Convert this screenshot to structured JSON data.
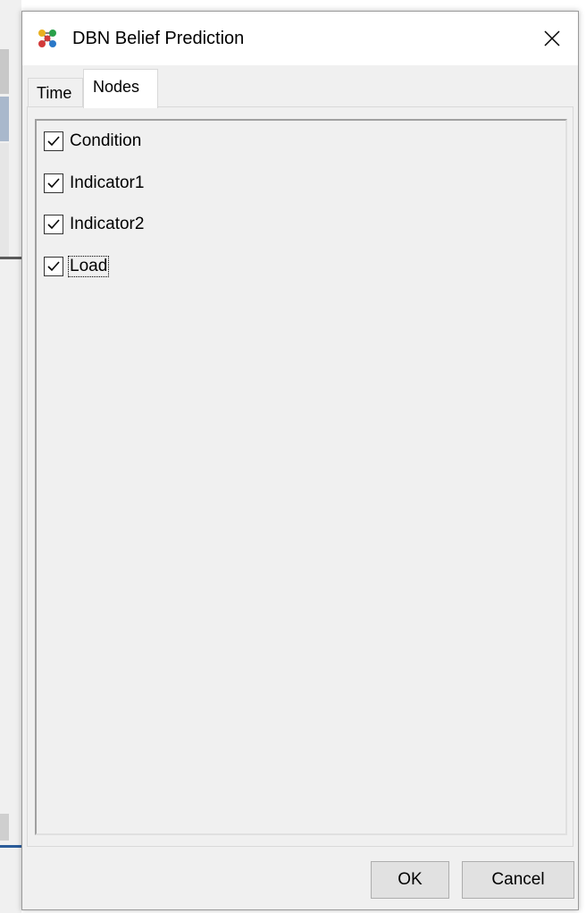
{
  "window": {
    "title": "DBN Belief Prediction"
  },
  "tabs": [
    {
      "label": "Time",
      "selected": false
    },
    {
      "label": "Nodes",
      "selected": true
    }
  ],
  "nodes": [
    {
      "label": "Condition",
      "checked": true
    },
    {
      "label": "Indicator1",
      "checked": true
    },
    {
      "label": "Indicator2",
      "checked": true
    },
    {
      "label": "Load",
      "checked": true,
      "focused": true
    }
  ],
  "buttons": {
    "ok_label": "OK",
    "cancel_label": "Cancel"
  },
  "icons": {
    "app": "network-graph-icon",
    "close": "close-icon",
    "check": "checkmark-icon"
  }
}
